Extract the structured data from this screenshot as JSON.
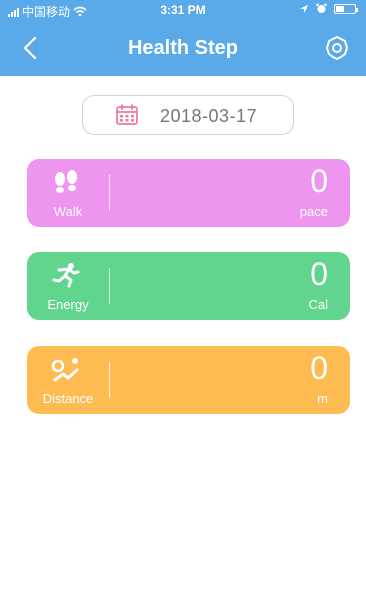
{
  "status_bar": {
    "carrier": "中国移动",
    "time": "3:31 PM"
  },
  "nav": {
    "title": "Health Step",
    "back_icon": "back-chevron-icon",
    "settings_icon": "gear-icon"
  },
  "date": {
    "value": "2018-03-17",
    "icon": "calendar-icon",
    "icon_color": "#f07aa0"
  },
  "cards": {
    "walk": {
      "label": "Walk",
      "value": "0",
      "unit": "pace",
      "icon": "footprints-icon",
      "color": "#ee95ef"
    },
    "energy": {
      "label": "Energy",
      "value": "0",
      "unit": "Cal",
      "icon": "runner-icon",
      "color": "#61d58e"
    },
    "distance": {
      "label": "Distance",
      "value": "0",
      "unit": "m",
      "icon": "route-pin-icon",
      "color": "#fdbb51"
    }
  },
  "colors": {
    "header": "#5aa9e8"
  }
}
